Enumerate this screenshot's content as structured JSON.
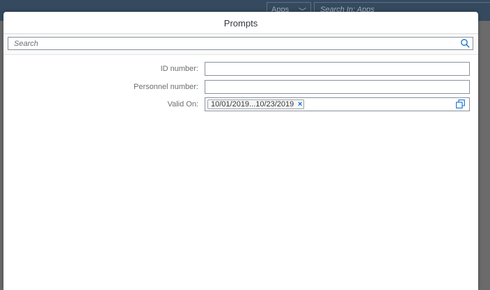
{
  "shell": {
    "apps_label": "Apps",
    "search_placeholder": "Search In: Apps"
  },
  "dialog": {
    "title": "Prompts",
    "search_placeholder": "Search",
    "fields": [
      {
        "label": "ID number:",
        "value": ""
      },
      {
        "label": "Personnel number:",
        "value": ""
      },
      {
        "label": "Valid On:",
        "token": "10/01/2019...10/23/2019",
        "token_close": "×"
      }
    ]
  },
  "colors": {
    "shell_bg": "#354a5f",
    "overlay": "#6b6b6b",
    "accent": "#0a6ed1"
  }
}
